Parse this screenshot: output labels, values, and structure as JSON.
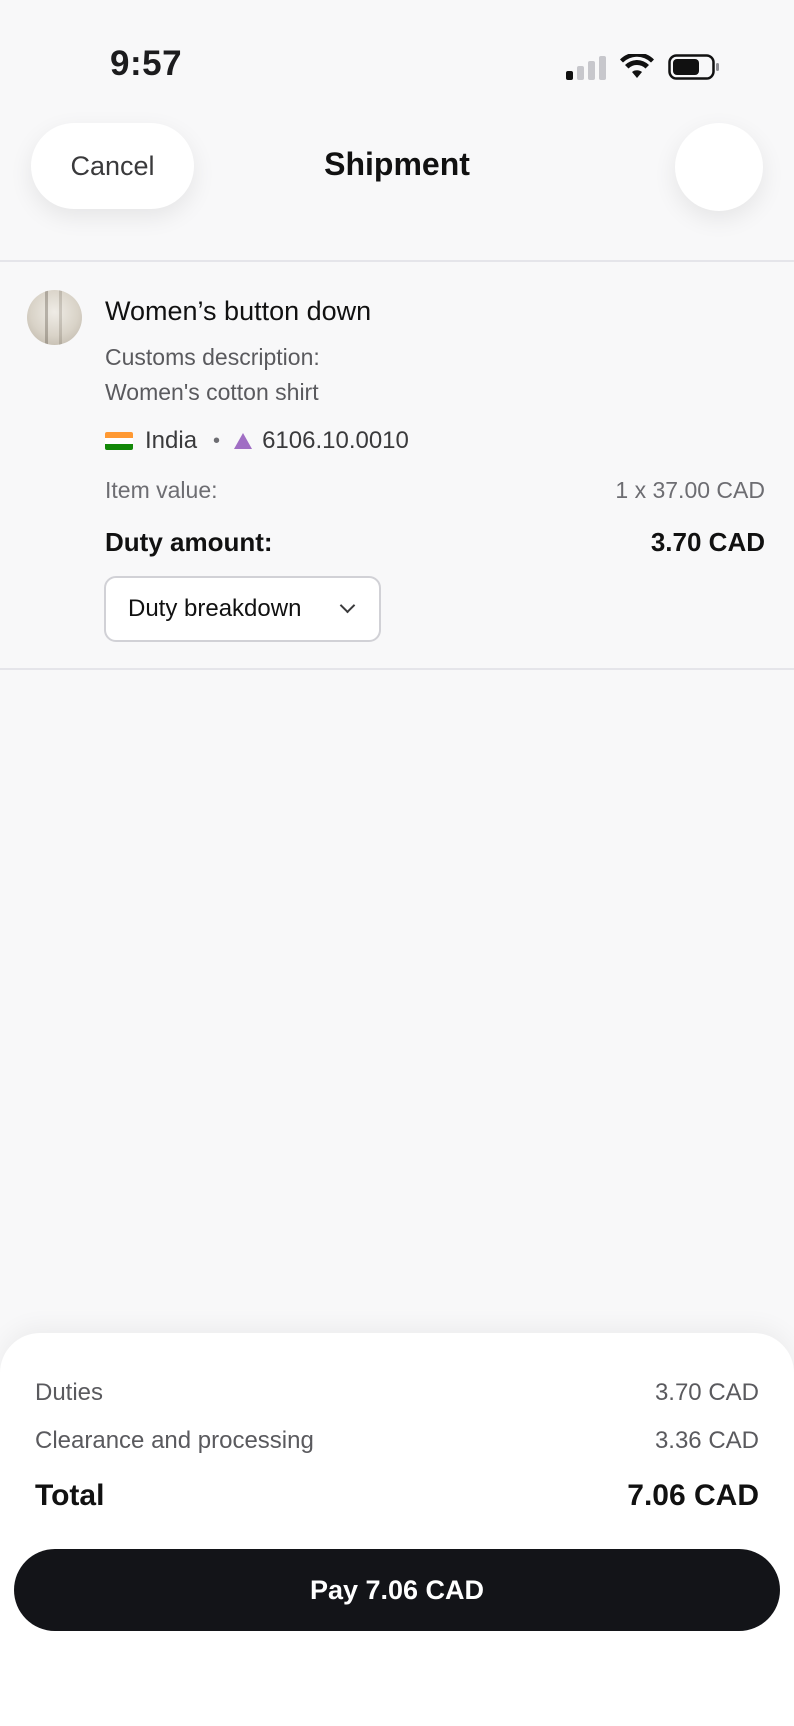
{
  "status_bar": {
    "time": "9:57",
    "icons": [
      "cellular-signal-icon",
      "wifi-icon",
      "battery-icon"
    ]
  },
  "nav": {
    "cancel_label": "Cancel",
    "title": "Shipment"
  },
  "item": {
    "name": "Women’s button down",
    "customs_label": "Customs description:",
    "customs_value": "Women's cotton shirt",
    "origin_country": "India",
    "hs_code": "6106.10.0010",
    "item_value_label": "Item value:",
    "item_value": "1 x 37.00 CAD",
    "duty_label": "Duty amount:",
    "duty_value": "3.70 CAD",
    "breakdown_label": "Duty breakdown"
  },
  "summary": {
    "duties_label": "Duties",
    "duties_value": "3.70 CAD",
    "clearance_label": "Clearance and processing",
    "clearance_value": "3.36 CAD",
    "total_label": "Total",
    "total_value": "7.06 CAD",
    "pay_label": "Pay 7.06 CAD"
  },
  "colors": {
    "background": "#f8f8f9",
    "pay_button": "#131418",
    "hs_icon": "#a06ec4",
    "flag": [
      "#ff9933",
      "#ffffff",
      "#138808"
    ]
  }
}
